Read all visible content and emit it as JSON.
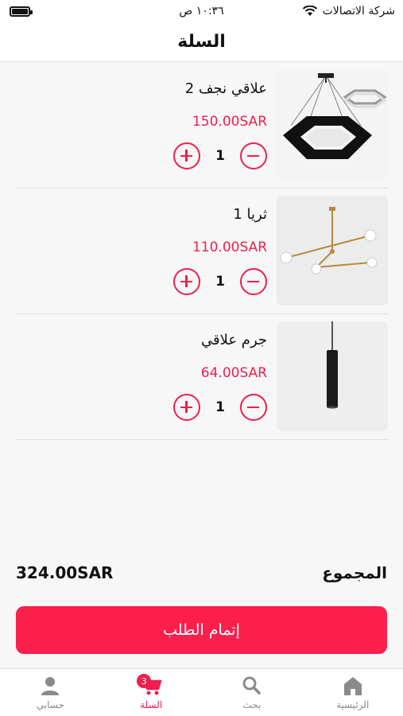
{
  "status_bar": {
    "carrier": "شركة الاتصالات",
    "time": "١٠:٣٦ ص"
  },
  "header": {
    "title": "السلة"
  },
  "cart": {
    "items": [
      {
        "name": "علاقي نجف 2",
        "price": "150.00SAR",
        "quantity": "1",
        "image": "hexagon-pendant-lamp"
      },
      {
        "name": "ثريا 1",
        "price": "110.00SAR",
        "quantity": "1",
        "image": "brass-sputnik-chandelier"
      },
      {
        "name": "جرم علاقي",
        "price": "64.00SAR",
        "quantity": "1",
        "image": "black-cylinder-pendant"
      }
    ]
  },
  "summary": {
    "total_label": "المجموع",
    "total_value": "324.00SAR"
  },
  "checkout": {
    "label": "إتمام الطلب"
  },
  "tab_bar": {
    "tabs": [
      {
        "label": "حسابي",
        "icon": "user-icon"
      },
      {
        "label": "السلة",
        "icon": "cart-icon",
        "badge": "3"
      },
      {
        "label": "بحث",
        "icon": "search-icon"
      },
      {
        "label": "الرئيسية",
        "icon": "home-icon"
      }
    ]
  },
  "colors": {
    "accent": "#ee1f4d",
    "checkout_bg": "#fb1f4c",
    "inactive": "#8a8a8a"
  }
}
